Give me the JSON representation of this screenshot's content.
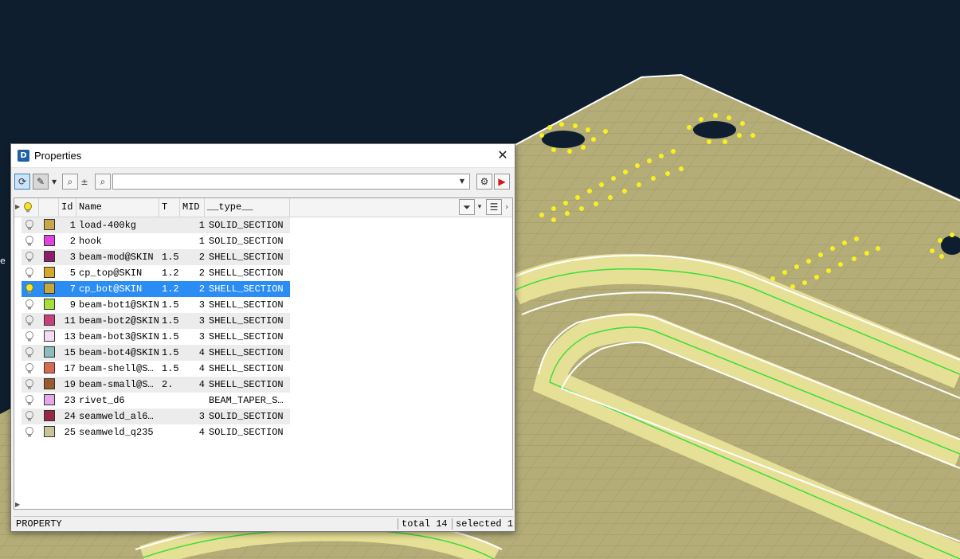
{
  "window": {
    "title": "Properties",
    "close_glyph": "✕"
  },
  "toolbar": {
    "buttons": [
      {
        "name": "refresh-icon",
        "glyph": "⟳"
      },
      {
        "name": "highlight-icon",
        "glyph": "✎"
      },
      {
        "name": "dropdown-arrow-icon",
        "glyph": "▾"
      },
      {
        "name": "zoom-icon",
        "glyph": "⌕"
      },
      {
        "name": "zoom-in-out-icon",
        "glyph": "±"
      },
      {
        "name": "search-icon",
        "glyph": "⌕"
      },
      {
        "name": "settings-icon",
        "glyph": "⚙"
      },
      {
        "name": "pick-cursor-icon",
        "glyph": "▶"
      }
    ],
    "search_value": ""
  },
  "table": {
    "columns": [
      "Id",
      "Name",
      "T",
      "MID",
      "__type__"
    ],
    "rows": [
      {
        "id": "1",
        "name": "load-400kg",
        "t": "",
        "mid": "1",
        "type": "SOLID_SECTION",
        "color": "#c6a84a",
        "lit": false
      },
      {
        "id": "2",
        "name": "hook",
        "t": "",
        "mid": "1",
        "type": "SOLID_SECTION",
        "color": "#e043e0",
        "lit": false
      },
      {
        "id": "3",
        "name": "beam-mod@SKIN",
        "t": "1.5",
        "mid": "2",
        "type": "SHELL_SECTION",
        "color": "#8c1e6e",
        "lit": false
      },
      {
        "id": "5",
        "name": "cp_top@SKIN",
        "t": "1.2",
        "mid": "2",
        "type": "SHELL_SECTION",
        "color": "#d6a82a",
        "lit": false
      },
      {
        "id": "7",
        "name": "cp_bot@SKIN",
        "t": "1.2",
        "mid": "2",
        "type": "SHELL_SECTION",
        "color": "#c8a838",
        "lit": true
      },
      {
        "id": "9",
        "name": "beam-bot1@SKIN",
        "t": "1.5",
        "mid": "3",
        "type": "SHELL_SECTION",
        "color": "#a8e03a",
        "lit": false
      },
      {
        "id": "11",
        "name": "beam-bot2@SKIN",
        "t": "1.5",
        "mid": "3",
        "type": "SHELL_SECTION",
        "color": "#c8407a",
        "lit": false
      },
      {
        "id": "13",
        "name": "beam-bot3@SKIN",
        "t": "1.5",
        "mid": "3",
        "type": "SHELL_SECTION",
        "color": "#f4dcf4",
        "lit": false
      },
      {
        "id": "15",
        "name": "beam-bot4@SKIN",
        "t": "1.5",
        "mid": "4",
        "type": "SHELL_SECTION",
        "color": "#8cbcbc",
        "lit": false
      },
      {
        "id": "17",
        "name": "beam-shell@S…",
        "t": "1.5",
        "mid": "4",
        "type": "SHELL_SECTION",
        "color": "#d86a50",
        "lit": false
      },
      {
        "id": "19",
        "name": "beam-small@S…",
        "t": "2.",
        "mid": "4",
        "type": "SHELL_SECTION",
        "color": "#9a5a30",
        "lit": false
      },
      {
        "id": "23",
        "name": "rivet_d6",
        "t": "",
        "mid": "",
        "type": "BEAM_TAPER_S…",
        "color": "#e2a8ec",
        "lit": false
      },
      {
        "id": "24",
        "name": "seamweld_al6…",
        "t": "",
        "mid": "3",
        "type": "SOLID_SECTION",
        "color": "#962846",
        "lit": false
      },
      {
        "id": "25",
        "name": "seamweld_q235",
        "t": "",
        "mid": "4",
        "type": "SOLID_SECTION",
        "color": "#c8c49a",
        "lit": false
      }
    ],
    "selected_id": "7"
  },
  "status": {
    "label": "PROPERTY",
    "total": "total 14",
    "selected": "selected 1"
  },
  "viewport": {
    "side_label": "e"
  }
}
